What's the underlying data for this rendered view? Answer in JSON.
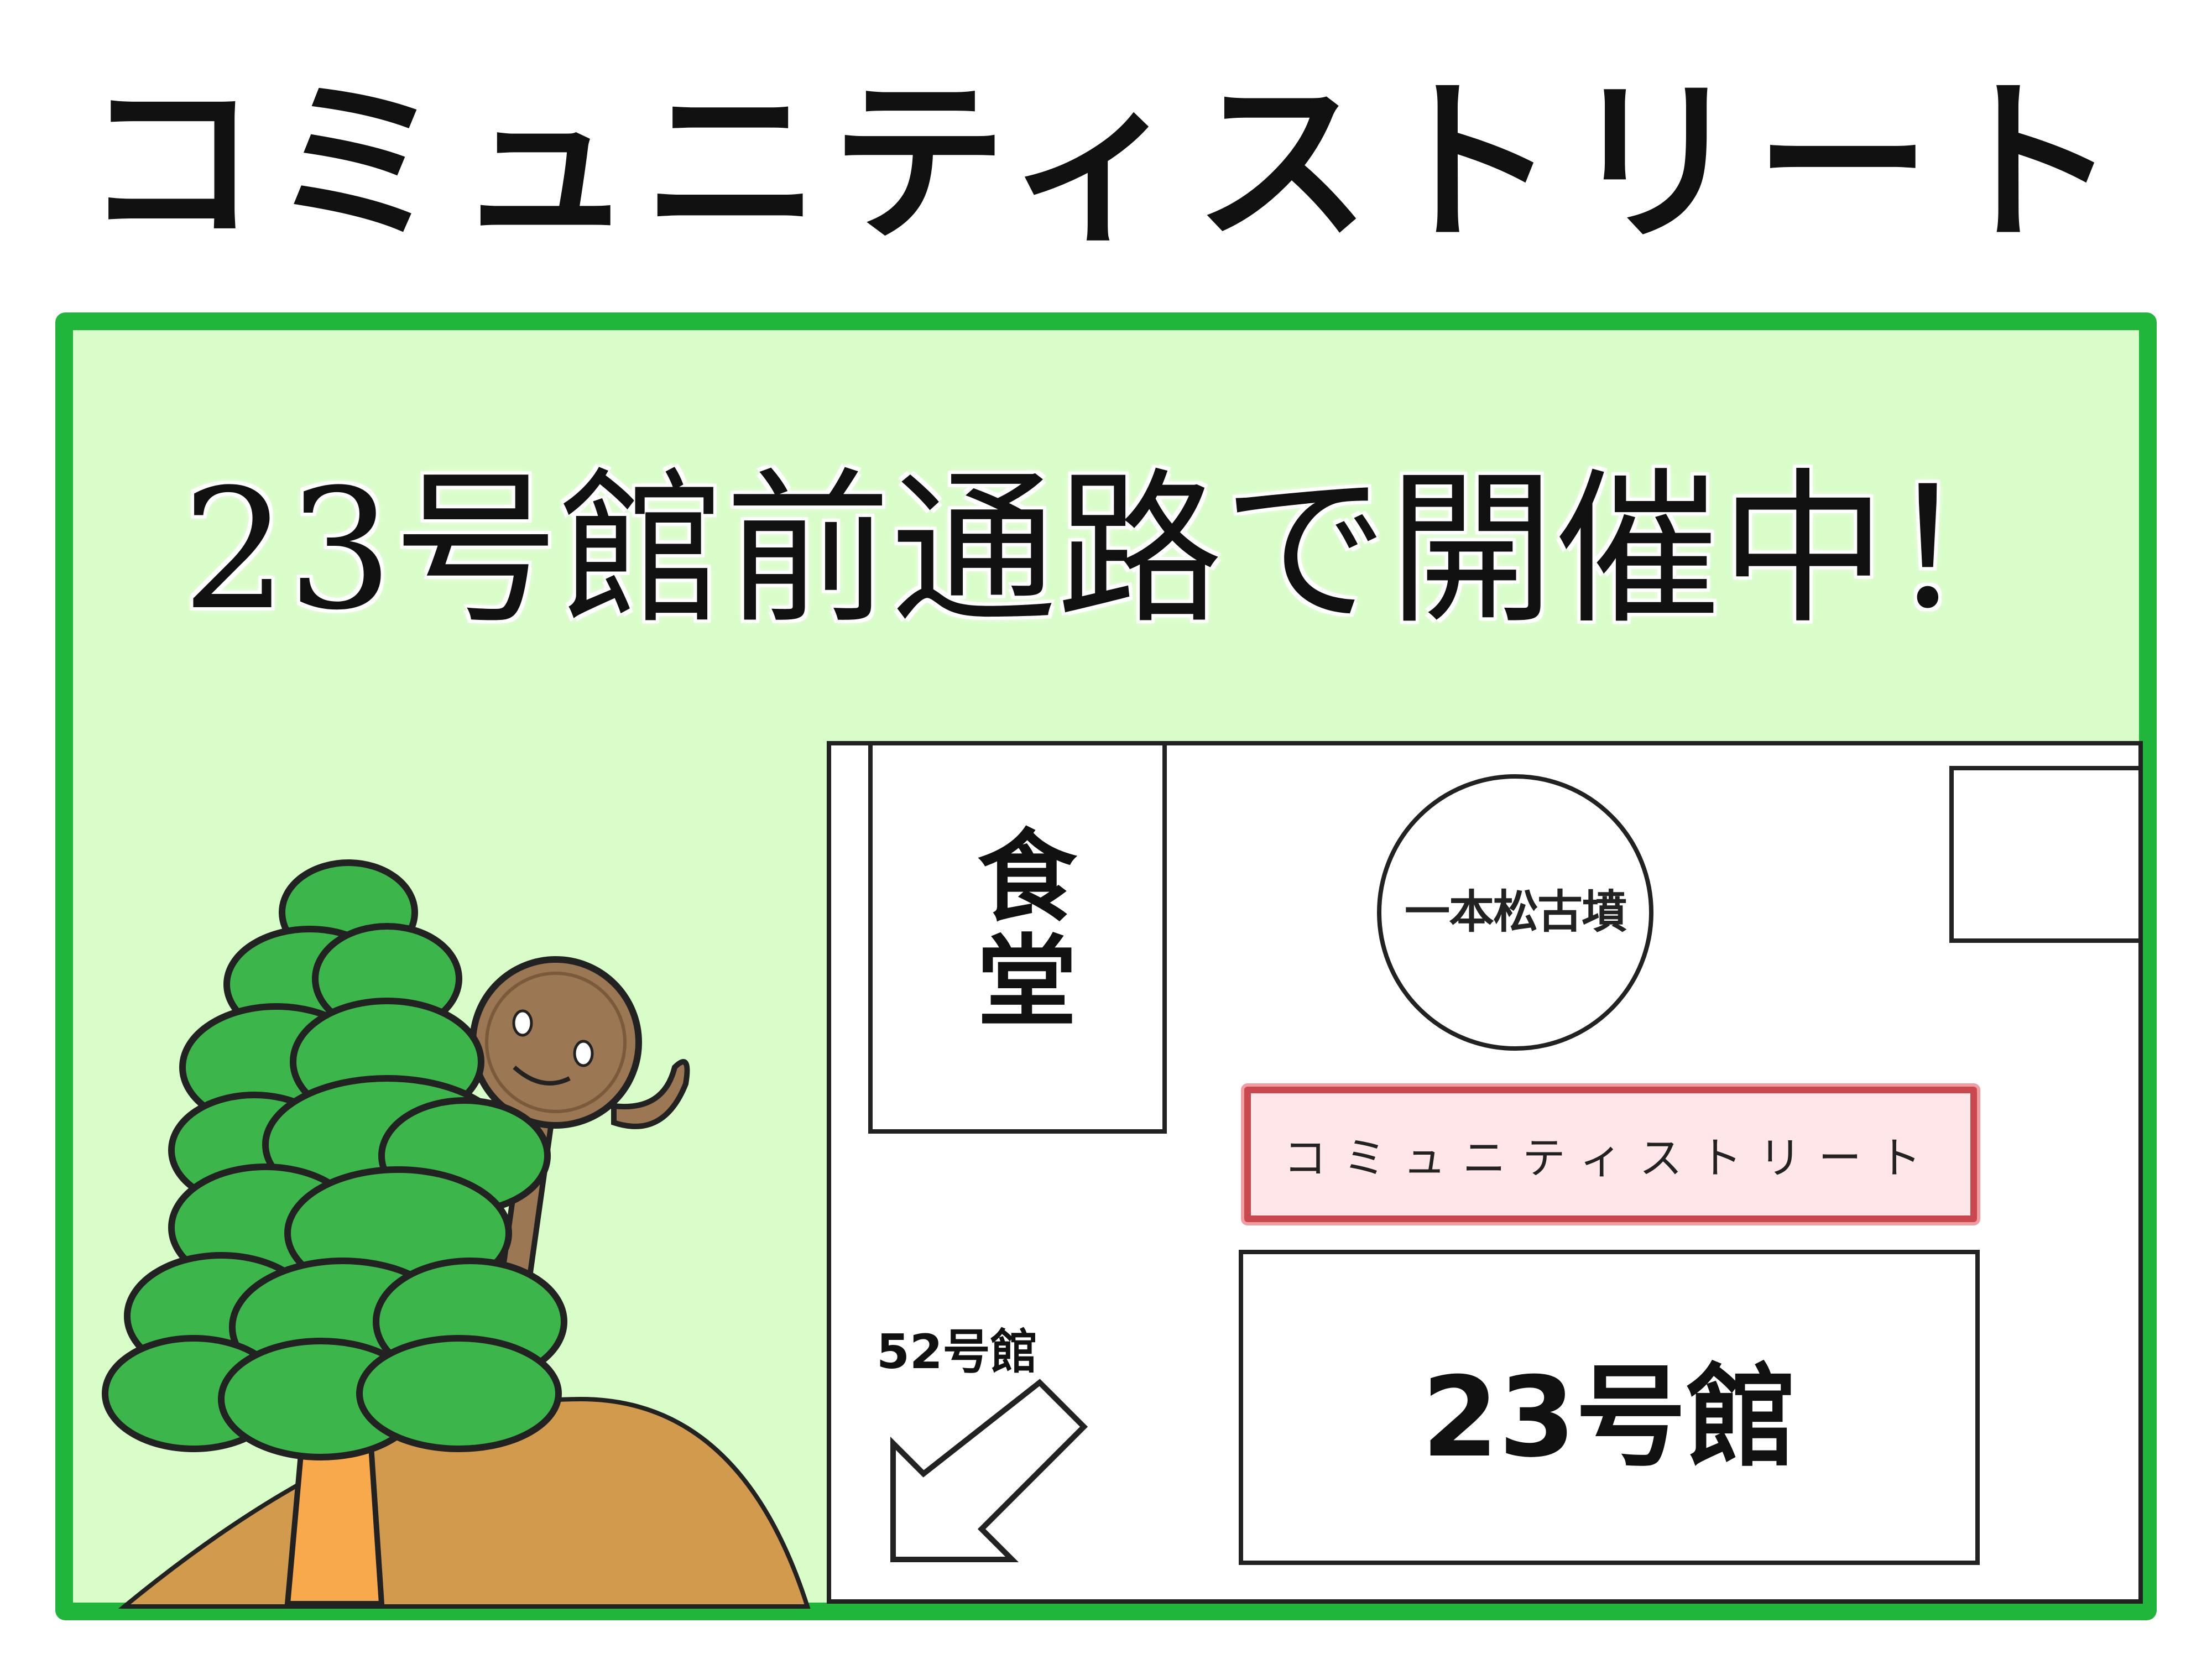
{
  "title": "コミュニティストリート",
  "headline": "23号館前通路で開催中！",
  "map": {
    "cafeteria": "食堂",
    "kofun": "一本松古墳",
    "street": "コミュニティストリート",
    "building_23": "23号館",
    "building_52": "52号館"
  },
  "colors": {
    "panel_bg": "#d9fdc9",
    "panel_border": "#20b63c",
    "street_fill": "#ffe6e8",
    "street_border": "#c9474e",
    "hill": "#d19a4d",
    "tree_green": "#3cb54a",
    "trunk": "#f7a94b",
    "mascot": "#9b7754"
  },
  "icons": [
    "pine-tree-icon",
    "mascot-character-icon",
    "arrow-down-left-icon"
  ]
}
